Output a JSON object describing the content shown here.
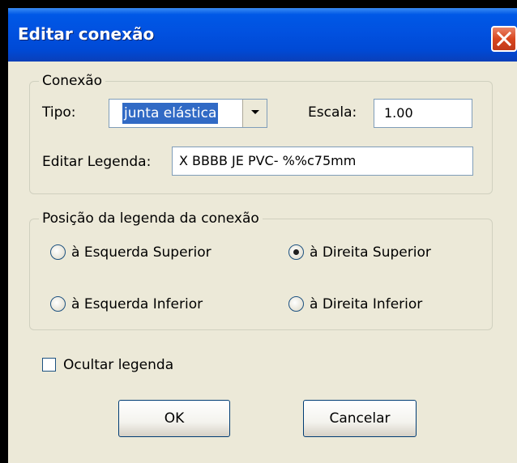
{
  "dialog": {
    "title": "Editar conexão"
  },
  "connection_group": {
    "legend": "Conexão",
    "tipo_label": "Tipo:",
    "tipo_value": "junta elástica",
    "escala_label": "Escala:",
    "escala_value": "1.00",
    "legenda_label": "Editar Legenda:",
    "legenda_value": "X BBBB JE PVC- %%c75mm"
  },
  "position_group": {
    "legend": "Posição da legenda da conexão",
    "options": [
      {
        "label": "à Esquerda Superior",
        "selected": false
      },
      {
        "label": "à Direita Superior",
        "selected": true
      },
      {
        "label": "à Esquerda Inferior",
        "selected": false
      },
      {
        "label": "à Direita Inferior",
        "selected": false
      }
    ]
  },
  "hide_legend": {
    "label": "Ocultar legenda",
    "checked": false
  },
  "buttons": {
    "ok": "OK",
    "cancel": "Cancelar"
  },
  "colors": {
    "titlebar": "#0053e0",
    "close": "#d9461e",
    "dialog_bg": "#ece9d8",
    "selection": "#316ac5"
  },
  "icons": {
    "close": "close-icon",
    "dropdown": "chevron-down-icon"
  }
}
